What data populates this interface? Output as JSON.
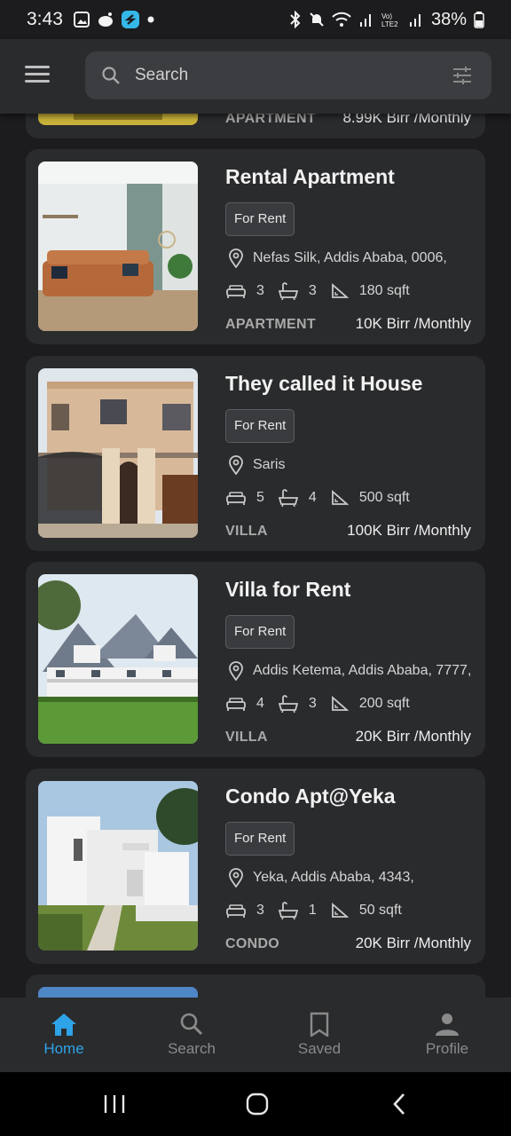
{
  "status_bar": {
    "time": "3:43",
    "battery": "38%"
  },
  "search": {
    "placeholder": "Search"
  },
  "listings": [
    {
      "title": "",
      "badge": "",
      "location": "",
      "beds": "",
      "baths": "",
      "area": "",
      "type": "APARTMENT",
      "price": "8.99K Birr /Monthly"
    },
    {
      "title": "Rental Apartment",
      "badge": "For Rent",
      "location": "Nefas Silk, Addis Ababa, 0006,",
      "beds": "3",
      "baths": "3",
      "area": "180 sqft",
      "type": "APARTMENT",
      "price": "10K Birr /Monthly"
    },
    {
      "title": "They called it House",
      "badge": "For Rent",
      "location": "Saris",
      "beds": "5",
      "baths": "4",
      "area": "500 sqft",
      "type": "VILLA",
      "price": "100K Birr /Monthly"
    },
    {
      "title": "Villa for Rent",
      "badge": "For Rent",
      "location": "Addis Ketema, Addis Ababa, 7777,",
      "beds": "4",
      "baths": "3",
      "area": "200 sqft",
      "type": "VILLA",
      "price": "20K Birr /Monthly"
    },
    {
      "title": "Condo Apt@Yeka",
      "badge": "For Rent",
      "location": "Yeka, Addis Ababa, 4343,",
      "beds": "3",
      "baths": "1",
      "area": "50 sqft",
      "type": "CONDO",
      "price": "20K Birr /Monthly"
    }
  ],
  "bottom_nav": [
    {
      "label": "Home",
      "icon": "home-icon",
      "active": true
    },
    {
      "label": "Search",
      "icon": "search-icon",
      "active": false
    },
    {
      "label": "Saved",
      "icon": "bookmark-icon",
      "active": false
    },
    {
      "label": "Profile",
      "icon": "person-icon",
      "active": false
    }
  ],
  "colors": {
    "background": "#1c1c1e",
    "card": "#2a2b2d",
    "accent": "#2fa3e7"
  }
}
